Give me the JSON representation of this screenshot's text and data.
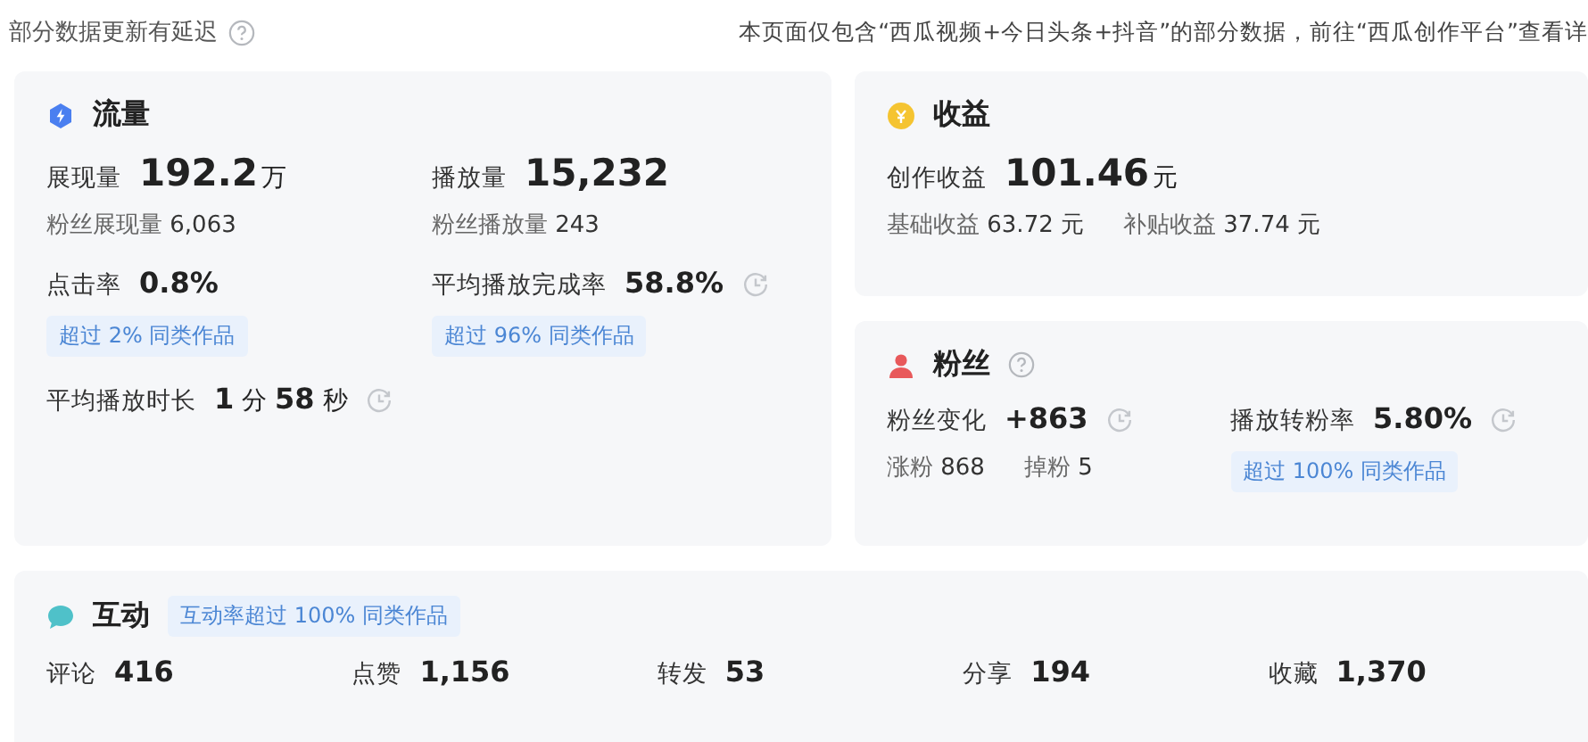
{
  "header": {
    "note": "部分数据更新有延迟",
    "notice": "本页面仅包含“西瓜视频+今日头条+抖音”的部分数据，前往“西瓜创作平台”查看详"
  },
  "traffic": {
    "kind": "traffic",
    "title": "流量",
    "help": false,
    "metrics": [
      {
        "kind": "large",
        "label": "展现量",
        "value": "192.2",
        "unit": "万",
        "history": false,
        "subs": [
          {
            "label": "粉丝展现量",
            "value": "6,063"
          }
        ]
      },
      {
        "kind": "large",
        "label": "播放量",
        "value": "15,232",
        "history": false,
        "subs": [
          {
            "label": "粉丝播放量",
            "value": "243"
          }
        ]
      },
      {
        "kind": "medium",
        "label": "点击率",
        "value": "0.8%",
        "history": false,
        "badge": "超过 2% 同类作品"
      },
      {
        "kind": "medium",
        "label": "平均播放完成率",
        "value": "58.8%",
        "history": true,
        "badge": "超过 96% 同类作品"
      },
      {
        "kind": "duration",
        "label": "平均播放时长",
        "value": "**1** 分 **58** 秒",
        "history": true
      }
    ]
  },
  "revenue": {
    "kind": "coin",
    "title": "收益",
    "help": false,
    "metrics": [
      {
        "kind": "large",
        "label": "创作收益",
        "value": "101.46",
        "unit": "元",
        "history": false,
        "subs": [
          {
            "label": "基础收益",
            "value": "63.72 元"
          },
          {
            "label": "补贴收益",
            "value": "37.74 元"
          }
        ]
      }
    ]
  },
  "fans": {
    "kind": "person",
    "title": "粉丝",
    "help": true,
    "metrics": [
      {
        "kind": "medium",
        "label": "粉丝变化",
        "value": "+863",
        "history": true,
        "subs": [
          {
            "label": "涨粉",
            "value": "868"
          },
          {
            "label": "掉粉",
            "value": "5"
          }
        ]
      },
      {
        "kind": "medium",
        "label": "播放转粉率",
        "value": "5.80%",
        "history": true,
        "badge": "超过 100% 同类作品"
      }
    ]
  },
  "interaction": {
    "kind": "chat",
    "title": "互动",
    "help": false,
    "badge": "互动率超过 100% 同类作品",
    "metrics": [
      {
        "kind": "medium",
        "label": "评论",
        "value": "416",
        "history": false
      },
      {
        "kind": "medium",
        "label": "点赞",
        "value": "1,156",
        "history": false
      },
      {
        "kind": "medium",
        "label": "转发",
        "value": "53",
        "history": false
      },
      {
        "kind": "medium",
        "label": "分享",
        "value": "194",
        "history": false
      },
      {
        "kind": "medium",
        "label": "收藏",
        "value": "1,370",
        "history": false
      }
    ]
  }
}
